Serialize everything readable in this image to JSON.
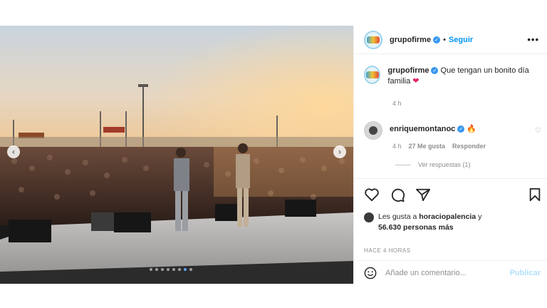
{
  "post": {
    "username": "grupofirme",
    "follow_label": "Seguir",
    "separator": "•",
    "more_label": "•••"
  },
  "media": {
    "stage_banner": "FIRME",
    "left_banner": "FIRME",
    "prev_icon": "chevron-left-icon",
    "next_icon": "chevron-right-icon",
    "slide_count": 8,
    "active_slide": 6
  },
  "caption": {
    "username": "grupofirme",
    "text": "Que tengan un bonito día familia",
    "emoji": "❤",
    "time": "4 h"
  },
  "comment": {
    "username": "enriquemontanoc",
    "emoji": "🔥",
    "time": "4 h",
    "likes": "27 Me gusta",
    "reply_label": "Responder",
    "view_replies": "Ver respuestas (1)"
  },
  "actions": {
    "like_icon": "heart-icon",
    "comment_icon": "comment-icon",
    "share_icon": "share-icon",
    "save_icon": "bookmark-icon"
  },
  "likes": {
    "prefix": "Les gusta a",
    "user": "horaciopalencia",
    "joiner": "y",
    "count": "56.630 personas más"
  },
  "age": "HACE 4 HORAS",
  "add_comment": {
    "placeholder": "Añade un comentario...",
    "publish_label": "Publicar"
  },
  "colors": {
    "accent": "#0095f6",
    "verified": "#3897f0",
    "heart": "#e0245e"
  }
}
